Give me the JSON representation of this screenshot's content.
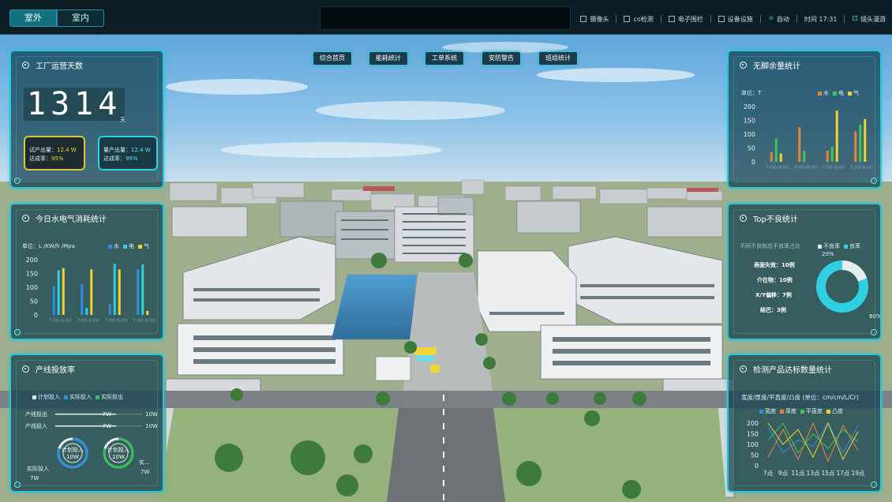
{
  "topbar": {
    "tabs": [
      "室外",
      "室内"
    ],
    "tools": [
      "摄像头",
      "co检测",
      "电子围栏",
      "设备设施",
      "自动",
      "时间 17:31",
      "镜头漫游"
    ]
  },
  "nav": [
    "综合首页",
    "能耗统计",
    "工单系统",
    "安防警告",
    "班组统计"
  ],
  "panel_days": {
    "title": "工厂运营天数",
    "value": "1314",
    "unit": "天",
    "trial": {
      "label1": "试产出量：",
      "val1": "12.4 W",
      "label2": "达成率：",
      "val2": "95%"
    },
    "mass": {
      "label1": "量产出量：",
      "val1": "12.4 W",
      "label2": "达成率：",
      "val2": "95%"
    }
  },
  "panel_energy": {
    "title": "今日水电气消耗统计",
    "unit": "单位：L /KW/h /Mpa",
    "legend": [
      "水",
      "电",
      "气"
    ],
    "colors": [
      "#2e8fe0",
      "#2fd0e0",
      "#f2d431"
    ],
    "chart_data": {
      "type": "bar",
      "categories": [
        "7:00-9:00",
        "7:00-9:00",
        "7:00-9:00",
        "7:00-9:00"
      ],
      "series": [
        {
          "name": "水",
          "values": [
            105,
            112,
            40,
            165
          ]
        },
        {
          "name": "电",
          "values": [
            162,
            25,
            185,
            183
          ]
        },
        {
          "name": "气",
          "values": [
            170,
            165,
            165,
            15
          ]
        }
      ],
      "ylim": [
        0,
        200
      ],
      "yticks": [
        0,
        50,
        100,
        150,
        200
      ]
    }
  },
  "panel_line": {
    "title": "产线投放率",
    "legend": [
      "计划投入",
      "实际投入",
      "实际投出"
    ],
    "colors": [
      "#d8e4e8",
      "#2e8fe0",
      "#31c15a"
    ],
    "rows": [
      {
        "label": "产线投出",
        "value": "7W",
        "max": "10W",
        "fraction": 0.7
      },
      {
        "label": "产线投入",
        "value": "7W",
        "max": "10W",
        "fraction": 0.7
      }
    ],
    "rings": [
      {
        "label": "计划投入",
        "value": "10W",
        "fraction": 0.8,
        "color": "#2e8fe0"
      },
      {
        "label": "计划投入",
        "value": "10W",
        "fraction": 0.8,
        "color": "#31c15a"
      }
    ],
    "side_labels": [
      "实际投入",
      "7W",
      "实...",
      "7W"
    ]
  },
  "panel_waste": {
    "title": "无脚余量统计",
    "unit": "单位：T",
    "legend": [
      "水",
      "电",
      "气"
    ],
    "colors": [
      "#e8843a",
      "#3fc45a",
      "#f2d431"
    ],
    "chart_data": {
      "type": "bar",
      "categories": [
        "7:00-9:00",
        "7:00-9:00",
        "7:00-9:00",
        "7:00-9:00"
      ],
      "series": [
        {
          "name": "水",
          "values": [
            35,
            125,
            40,
            110
          ]
        },
        {
          "name": "电",
          "values": [
            85,
            40,
            55,
            135
          ]
        },
        {
          "name": "气",
          "values": [
            30,
            0,
            185,
            155
          ]
        }
      ],
      "ylim": [
        0,
        200
      ],
      "yticks": [
        0,
        50,
        100,
        150,
        200
      ]
    }
  },
  "panel_top": {
    "title": "Top不良统计",
    "subtitle": "不同不良和总不良率占比",
    "legend": [
      "不良率",
      "良率"
    ],
    "colors": [
      "#e6eef0",
      "#2fd0e0"
    ],
    "items": [
      "表面失效：10例",
      "介在物：10例",
      "X/Y偏移：7例",
      "结巴：3例"
    ],
    "chart_data": {
      "type": "pie",
      "labels": [
        "不良率",
        "良率"
      ],
      "values": [
        20,
        80
      ],
      "value_labels": [
        "20%",
        "80%"
      ]
    }
  },
  "panel_quality": {
    "title": "检测产品达标数量统计",
    "unit": "宽度/厚度/平直度/凸度 (单位：cm/cm/L/Cr)",
    "legend": [
      "宽度",
      "厚度",
      "平直度",
      "凸度"
    ],
    "colors": [
      "#2e8fe0",
      "#e8843a",
      "#3fc45a",
      "#f2d431"
    ],
    "chart_data": {
      "type": "line",
      "x": [
        "7点",
        "9点",
        "11点",
        "13点",
        "15点",
        "17点",
        "19点"
      ],
      "series": [
        {
          "name": "宽度",
          "values": [
            180,
            60,
            120,
            90,
            200,
            60,
            190
          ]
        },
        {
          "name": "厚度",
          "values": [
            40,
            170,
            30,
            210,
            20,
            190,
            70
          ]
        },
        {
          "name": "平直度",
          "values": [
            120,
            200,
            60,
            150,
            80,
            170,
            110
          ]
        },
        {
          "name": "凸度",
          "values": [
            200,
            100,
            170,
            40,
            210,
            30,
            160
          ]
        }
      ],
      "ylim": [
        0,
        200
      ],
      "yticks": [
        0,
        50,
        100,
        150,
        200
      ]
    }
  }
}
